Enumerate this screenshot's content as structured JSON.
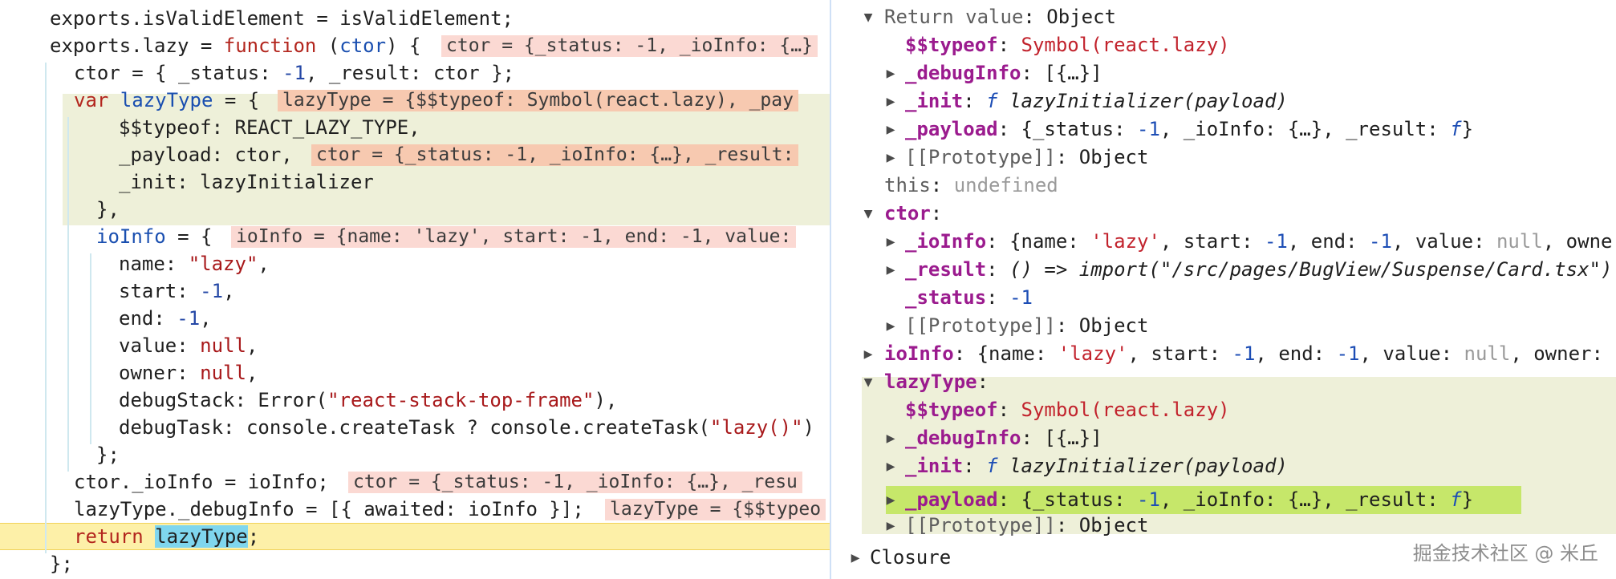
{
  "editor": {
    "lines": [
      {
        "code": "exports.isValidElement = isValidElement;"
      },
      {
        "code_a": "exports.lazy = ",
        "kw": "function",
        "code_b": " (",
        "param": "ctor",
        "code_c": ") {",
        "inline": "ctor = {_status: -1, _ioInfo: {…}"
      },
      {
        "code_a": "ctor = { _status: ",
        "num": "-1",
        "code_b": ", _result: ctor };"
      },
      {
        "kw": "var",
        "var": " lazyType",
        "code_a": " = {",
        "inline": "lazyType = {$$typeof: Symbol(react.lazy), _pay"
      },
      {
        "code": "$$typeof: REACT_LAZY_TYPE,"
      },
      {
        "code": "_payload: ctor,",
        "inline": "ctor = {_status: -1, _ioInfo: {…}, _result:"
      },
      {
        "code": "_init: lazyInitializer"
      },
      {
        "code": "},"
      },
      {
        "var": "ioInfo",
        "code_a": " = {",
        "inline": "ioInfo = {name: 'lazy', start: -1, end: -1, value:"
      },
      {
        "code_a": "name: ",
        "str": "\"lazy\"",
        "code_b": ","
      },
      {
        "code_a": "start: ",
        "num": "-1",
        "code_b": ","
      },
      {
        "code_a": "end: ",
        "num": "-1",
        "code_b": ","
      },
      {
        "code_a": "value: ",
        "nul": "null",
        "code_b": ","
      },
      {
        "code_a": "owner: ",
        "nul": "null",
        "code_b": ","
      },
      {
        "code_a": "debugStack: Error(",
        "str": "\"react-stack-top-frame\"",
        "code_b": "),"
      },
      {
        "code_a": "debugTask: console.createTask ? console.createTask(",
        "str": "\"lazy()\"",
        "code_b": ")"
      },
      {
        "code": "};"
      },
      {
        "code": "ctor._ioInfo = ioInfo;",
        "inline": "ctor = {_status: -1, _ioInfo: {…}, _resu"
      },
      {
        "code": "lazyType._debugInfo = [{ awaited: ioInfo }];",
        "inline": "lazyType = {$$typeo"
      },
      {
        "kw": "return",
        "sel": "lazyType",
        "code_b": ";"
      },
      {
        "code": "};"
      }
    ]
  },
  "scope": {
    "return_value": {
      "key": "Return value",
      "value": "Object"
    },
    "rv_typeof": {
      "key": "$$typeof",
      "value": "Symbol(react.lazy)"
    },
    "rv_debuginfo": {
      "key": "_debugInfo",
      "value": "[{…}]"
    },
    "rv_init": {
      "key": "_init",
      "f": "f",
      "value": "lazyInitializer(payload)"
    },
    "rv_payload": {
      "key": "_payload",
      "a": "{_status: ",
      "num": "-1",
      "b": ", _ioInfo: {…}, _result: ",
      "f": "f",
      "c": "}"
    },
    "rv_proto": {
      "key": "[[Prototype]]",
      "value": "Object"
    },
    "this": {
      "key": "this",
      "value": "undefined"
    },
    "ctor": {
      "key": "ctor"
    },
    "ctor_ioinfo": {
      "key": "_ioInfo",
      "a": "{name: ",
      "str": "'lazy'",
      "b": ", start: ",
      "n1": "-1",
      "c": ", end: ",
      "n2": "-1",
      "d": ", value: ",
      "nul": "null",
      "e": ", owne"
    },
    "ctor_result": {
      "key": "_result",
      "value": "() => import(\"/src/pages/BugView/Suspense/Card.tsx\")"
    },
    "ctor_status": {
      "key": "_status",
      "value": "-1"
    },
    "ctor_proto": {
      "key": "[[Prototype]]",
      "value": "Object"
    },
    "ioinfo": {
      "key": "ioInfo",
      "a": "{name: ",
      "str": "'lazy'",
      "b": ", start: ",
      "n1": "-1",
      "c": ", end: ",
      "n2": "-1",
      "d": ", value: ",
      "nul": "null",
      "e": ", owner:"
    },
    "lazytype": {
      "key": "lazyType"
    },
    "lt_typeof": {
      "key": "$$typeof",
      "value": "Symbol(react.lazy)"
    },
    "lt_debuginfo": {
      "key": "_debugInfo",
      "value": "[{…}]"
    },
    "lt_init": {
      "key": "_init",
      "f": "f",
      "value": "lazyInitializer(payload)"
    },
    "lt_payload": {
      "key": "_payload",
      "a": "{_status: ",
      "num": "-1",
      "b": ", _ioInfo: {…}, _result: ",
      "f": "f",
      "c": "}"
    },
    "lt_proto": {
      "key": "[[Prototype]]",
      "value": "Object"
    },
    "closure": {
      "key": "Closure"
    }
  },
  "watermark": "掘金技术社区 @ 米丘"
}
